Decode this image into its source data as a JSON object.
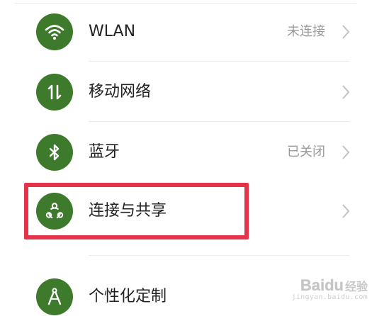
{
  "settings": {
    "items": [
      {
        "key": "wlan",
        "label": "WLAN",
        "status": "未连接",
        "icon": "wifi-icon"
      },
      {
        "key": "mobile-network",
        "label": "移动网络",
        "status": "",
        "icon": "mobile-data-icon"
      },
      {
        "key": "bluetooth",
        "label": "蓝牙",
        "status": "已关闭",
        "icon": "bluetooth-icon"
      },
      {
        "key": "connection-sharing",
        "label": "连接与共享",
        "status": "",
        "icon": "share-nodes-icon"
      },
      {
        "key": "personalization",
        "label": "个性化定制",
        "status": "",
        "icon": "compass-icon"
      }
    ]
  },
  "annotation": {
    "highlight_color": "#e5334a"
  },
  "theme": {
    "icon_bg": "#3d7a2c"
  },
  "watermark": {
    "logo": "Baidu",
    "logo_cn": "经验",
    "url": "jingyan.baidu.com"
  }
}
